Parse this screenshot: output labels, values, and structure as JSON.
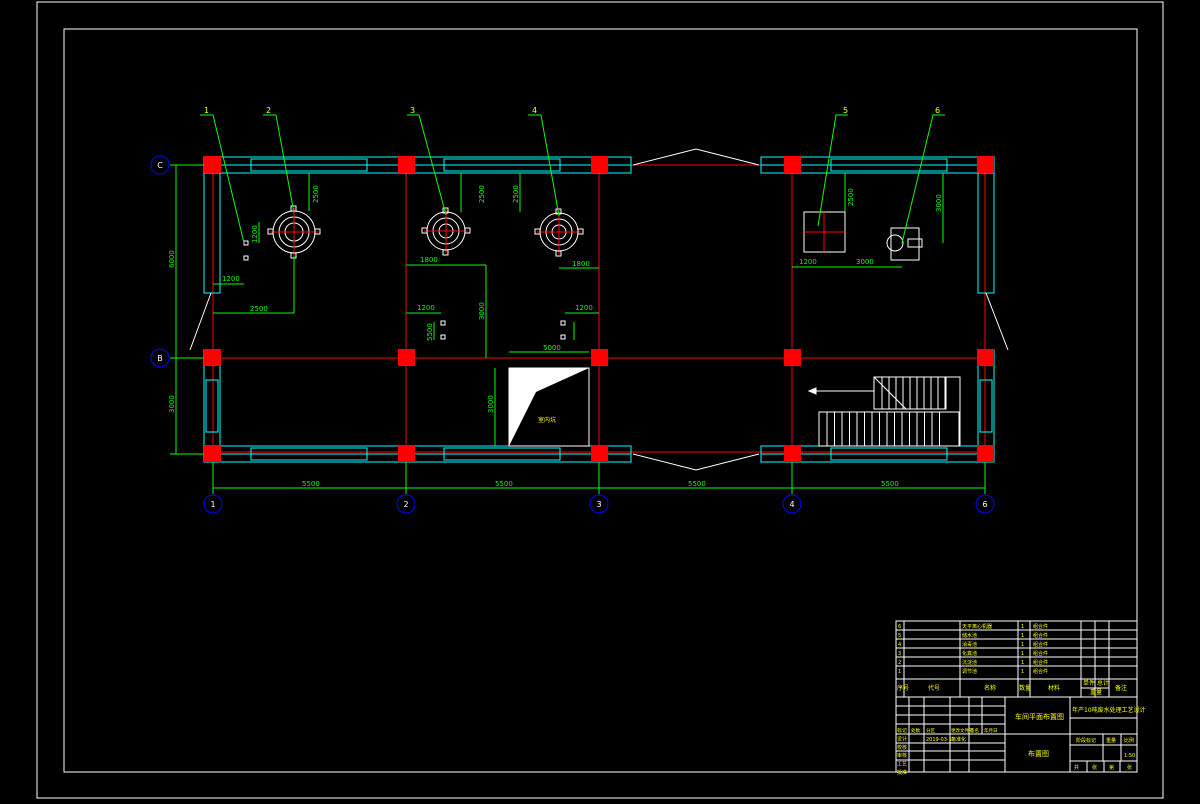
{
  "drawing": {
    "axes_horizontal": [
      "1",
      "2",
      "3",
      "4",
      "6"
    ],
    "axes_vertical": [
      "C",
      "B"
    ],
    "bay_dimensions": [
      "5500",
      "5500",
      "5500",
      "5500"
    ],
    "callouts": [
      "1",
      "2",
      "3",
      "4",
      "5",
      "6"
    ],
    "dims": {
      "d2500a": "2500",
      "d2500b": "2500",
      "d2500c": "2500",
      "d2500d": "2500",
      "d3000": "3000",
      "d1200a": "1200",
      "d1200b": "1200",
      "d1200c": "1200",
      "d1200d": "1200",
      "d1200e": "1200",
      "d1800a": "1800",
      "d1800b": "1800",
      "d3000h": "3000",
      "d5500": "5500",
      "d3000v": "3000",
      "d6000": "6000",
      "d5000": "5000",
      "d2500e": "2500",
      "d3000g": "3000",
      "dside": "3000"
    },
    "inner_note": "室内坑",
    "colors": {
      "background": "#000000",
      "frame": "#ffffff",
      "wall": "#00ffff",
      "column": "#ff0000",
      "axis": "#ff0000",
      "dimension": "#00ff00",
      "leader": "#00ff00",
      "callout_text": "#ffff00",
      "axis_bubble": "#0000ff"
    }
  },
  "title_block": {
    "parts_rows": [
      {
        "no": "6",
        "name": "天平离心机器",
        "qty": "1",
        "material": "组合件"
      },
      {
        "no": "5",
        "name": "储水池",
        "qty": "1",
        "material": "组合件"
      },
      {
        "no": "4",
        "name": "消毒池",
        "qty": "1",
        "material": "组合件"
      },
      {
        "no": "3",
        "name": "化粪池",
        "qty": "1",
        "material": "组合件"
      },
      {
        "no": "2",
        "name": "沉淀池",
        "qty": "1",
        "material": "组合件"
      },
      {
        "no": "1",
        "name": "调节池",
        "qty": "1",
        "material": "组合件"
      }
    ],
    "header": {
      "no": "序号",
      "code": "代号",
      "name": "名称",
      "qty": "数量",
      "material": "材料",
      "unit_weight": "单件",
      "total_weight": "总计",
      "weight": "重量",
      "remark": "备注"
    },
    "drawing_title": "车间平面布置图",
    "project_title": "年产10吨废水处理工艺设计",
    "layout_title": "布置图",
    "sign_rows": [
      "标记",
      "设计",
      "校核",
      "审核",
      "工艺",
      "批准"
    ],
    "sign_cols": [
      "处数",
      "分区",
      "更改文件号",
      "签名",
      "年月日"
    ],
    "date": "2019-03-17",
    "standardization": "标准化",
    "stage_label": "阶段标记",
    "weight_label": "重量",
    "scale_label": "比例",
    "scale": "1:50",
    "sheet_text": [
      "共",
      "张",
      "第",
      "张"
    ]
  }
}
